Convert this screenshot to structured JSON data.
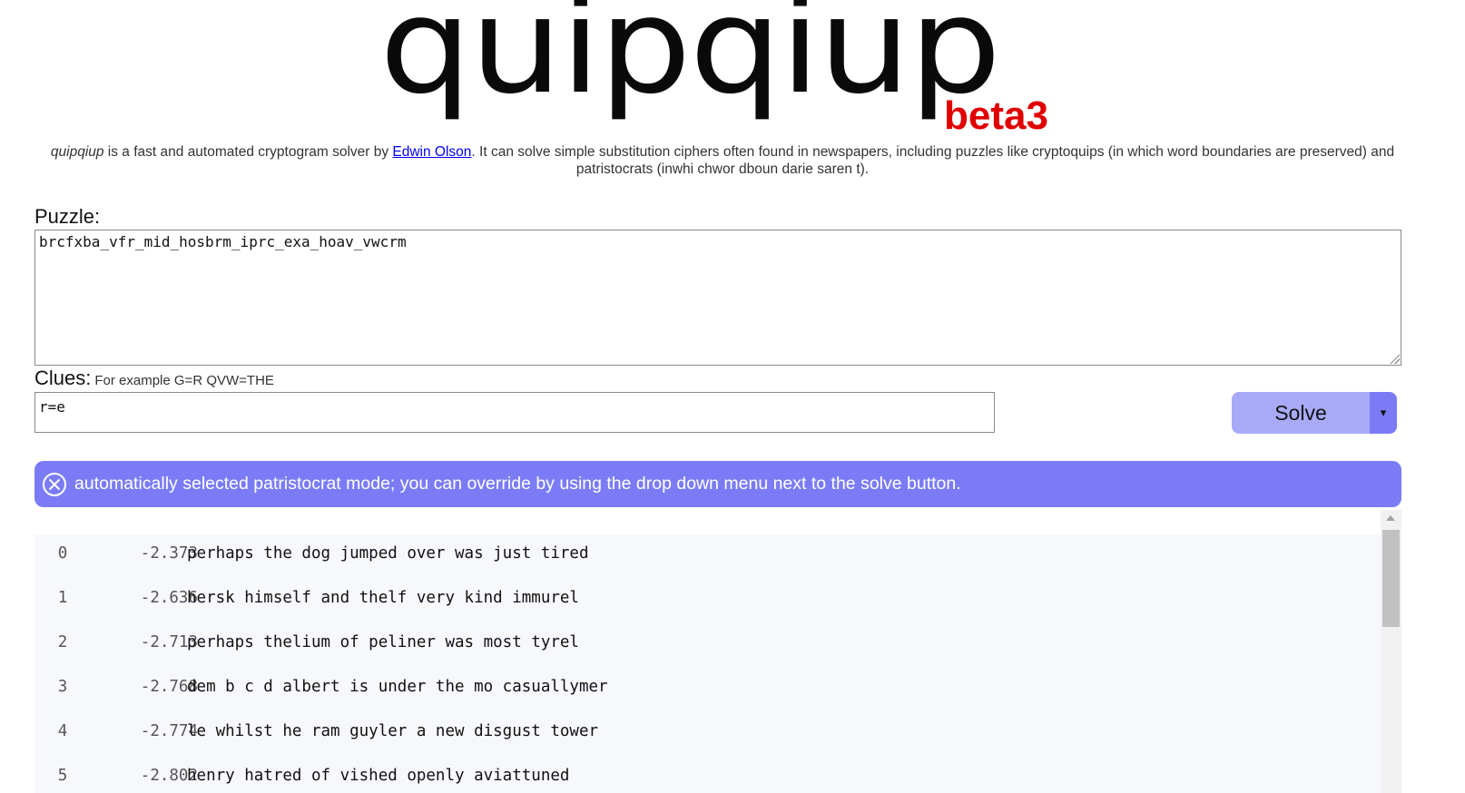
{
  "logo": {
    "title": "quipqiup",
    "version": "beta3"
  },
  "intro": {
    "app_name": "quipqiup",
    "text_before_link": " is a fast and automated cryptogram solver by ",
    "author_link": "Edwin Olson",
    "text_after_link": ". It can solve simple substitution ciphers often found in newspapers, including puzzles like cryptoquips (in which word boundaries are preserved) and patristocrats (inwhi chwor dboun darie saren t)."
  },
  "puzzle": {
    "label": "Puzzle:",
    "value": "brcfxba_vfr_mid_hosbrm_iprc_exa_hoav_vwcrm"
  },
  "clues": {
    "label": "Clues:",
    "hint": "For example G=R QVW=THE",
    "value": "r=e"
  },
  "solve": {
    "label": "Solve",
    "caret": "▾"
  },
  "alert": {
    "message": "automatically selected patristocrat mode; you can override by using the drop down menu next to the solve button."
  },
  "results": [
    {
      "index": "0",
      "score": "-2.373",
      "text": "perhaps the dog jumped over was just tired"
    },
    {
      "index": "1",
      "score": "-2.636",
      "text": "hersk himself and thelf very kind immurel"
    },
    {
      "index": "2",
      "score": "-2.713",
      "text": "perhaps thelium of peliner was most tyrel"
    },
    {
      "index": "3",
      "score": "-2.768",
      "text": "dem b c d albert is under the mo casuallymer"
    },
    {
      "index": "4",
      "score": "-2.774",
      "text": "le whilst he ram guyler a new disgust tower"
    },
    {
      "index": "5",
      "score": "-2.802",
      "text": "henry hatred of vished openly aviattuned"
    }
  ],
  "colors": {
    "accent": "#7b7cf5",
    "solve_button": "#a8aaf7",
    "beta": "#e00000",
    "link": "#0000ee"
  }
}
